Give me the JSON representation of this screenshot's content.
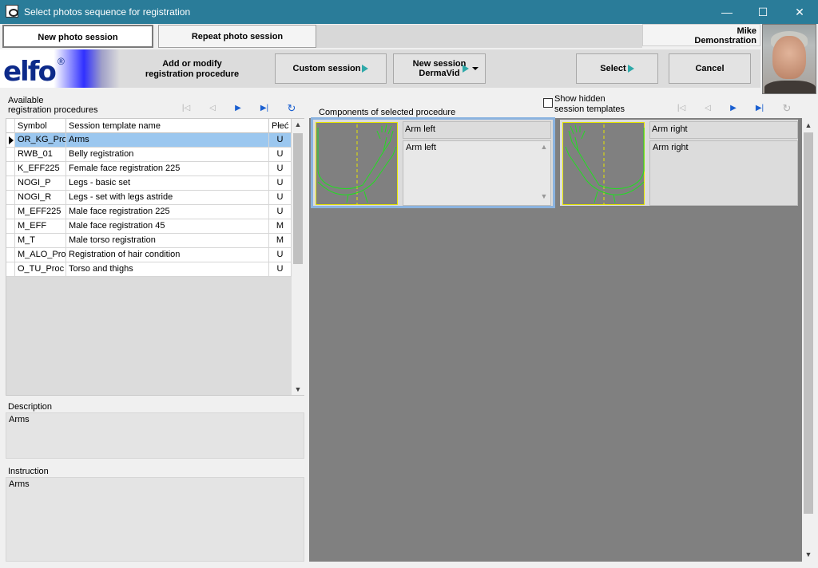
{
  "window": {
    "title": "Select photos sequence for registration",
    "minimize": "—",
    "maximize": "☐",
    "close": "✕"
  },
  "tabs": {
    "new_session": "New photo session",
    "repeat_session": "Repeat photo session"
  },
  "user": {
    "first_name": "Mike",
    "last_name": "Demonstration"
  },
  "toolbar": {
    "logo_text": "elfo",
    "logo_reg": "®",
    "add_modify_line1": "Add or modify",
    "add_modify_line2": "registration procedure",
    "custom_session": "Custom session",
    "new_session_line1": "New session",
    "new_session_line2": "DermaVid",
    "select": "Select",
    "cancel": "Cancel"
  },
  "left": {
    "available_line1": "Available",
    "available_line2": "registration procedures",
    "columns": {
      "symbol": "Symbol",
      "name": "Session template name",
      "sex": "Płeć"
    },
    "rows": [
      {
        "symbol": "OR_KG_Proc",
        "name": "Arms",
        "sex": "U"
      },
      {
        "symbol": "RWB_01",
        "name": "Belly registration",
        "sex": "U"
      },
      {
        "symbol": "K_EFF225",
        "name": "Female face registration 225",
        "sex": "U"
      },
      {
        "symbol": "NOGI_P",
        "name": "Legs - basic set",
        "sex": "U"
      },
      {
        "symbol": "NOGI_R",
        "name": "Legs - set with legs astride",
        "sex": "U"
      },
      {
        "symbol": "M_EFF225",
        "name": "Male face registration 225",
        "sex": "U"
      },
      {
        "symbol": "M_EFF",
        "name": "Male face registration 45",
        "sex": "M"
      },
      {
        "symbol": "M_T",
        "name": "Male torso registration",
        "sex": "M"
      },
      {
        "symbol": "M_ALO_Proc",
        "name": "Registration of hair condition",
        "sex": "U"
      },
      {
        "symbol": "O_TU_Proc",
        "name": "Torso and thighs",
        "sex": "U"
      }
    ],
    "selected_index": 0,
    "description_label": "Description",
    "description_value": "Arms",
    "instruction_label": "Instruction",
    "instruction_value": "Arms"
  },
  "right": {
    "components_label": "Components of selected procedure",
    "show_hidden_line1": "Show hidden",
    "show_hidden_line2": "session templates",
    "components": [
      {
        "title": "Arm left",
        "description": "Arm left"
      },
      {
        "title": "Arm right",
        "description": "Arm right"
      }
    ]
  },
  "nav": {
    "first": "|◁",
    "prev": "◁",
    "next": "▶",
    "last": "▶|",
    "refresh": "↻"
  },
  "colors": {
    "titlebar": "#2a7c99",
    "selection": "#9bc7ef",
    "nav_enabled": "#1a5fd0",
    "arrow_accent": "#2fa9a9",
    "outline_green": "#22dd22",
    "frame_yellow": "#e6e600"
  }
}
